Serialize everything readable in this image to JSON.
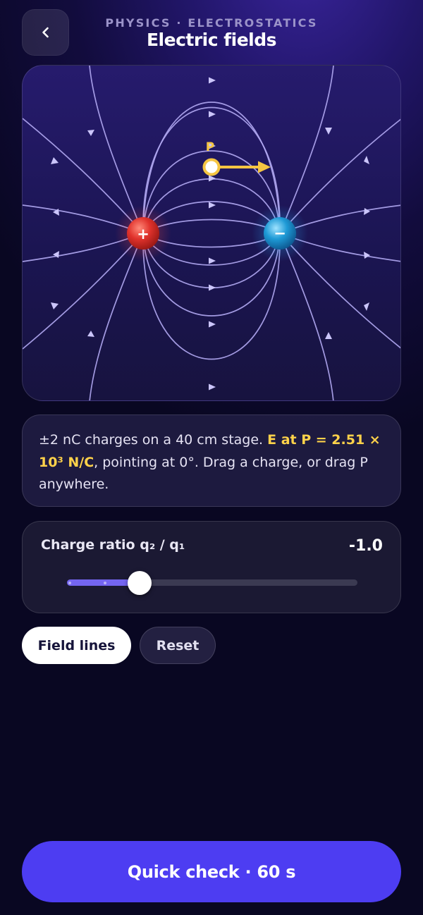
{
  "header": {
    "eyebrow": "PHYSICS · ELECTROSTATICS",
    "title": "Electric fields"
  },
  "stage": {
    "probe_label": "P",
    "positive_charge_symbol": "+",
    "negative_charge_symbol": "−",
    "field_direction_degrees": 0
  },
  "info": {
    "text_before": "±2 nC charges on a 40 cm stage. ",
    "highlight": "E at P = 2.51 × 10³ N/C",
    "text_after": ", pointing at 0°. Drag a charge, or drag P anywhere."
  },
  "slider": {
    "label": "Charge ratio q₂ / q₁",
    "value_text": "-1.0",
    "fraction": 0.25
  },
  "chips": {
    "field_lines": "Field lines",
    "reset": "Reset"
  },
  "cta": {
    "label": "Quick check · 60 s"
  },
  "colors": {
    "accent": "#4d3df2",
    "highlight": "#ffd24a",
    "positive_charge": "#e0322c",
    "negative_charge": "#1e9ad6",
    "field_line": "#b2aaf3"
  },
  "icons": {
    "back": "chevron-left-icon"
  }
}
